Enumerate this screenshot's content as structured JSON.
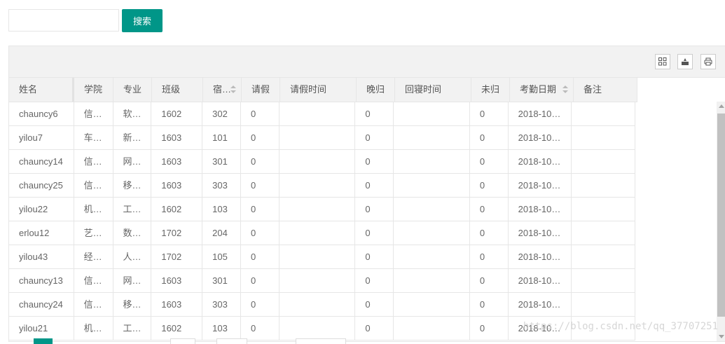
{
  "search": {
    "placeholder": "",
    "value": "",
    "button_label": "搜索"
  },
  "toolbar": {
    "icons": [
      "columns-icon",
      "export-icon",
      "print-icon"
    ]
  },
  "columns": [
    {
      "key": "name",
      "label": "姓名",
      "sortable": false
    },
    {
      "key": "college",
      "label": "学院",
      "sortable": false
    },
    {
      "key": "major",
      "label": "专业",
      "sortable": false
    },
    {
      "key": "class",
      "label": "班级",
      "sortable": false
    },
    {
      "key": "dorm",
      "label": "宿…",
      "sortable": true
    },
    {
      "key": "leave",
      "label": "请假",
      "sortable": false
    },
    {
      "key": "leave_time",
      "label": "请假时间",
      "sortable": false
    },
    {
      "key": "late",
      "label": "晚归",
      "sortable": false
    },
    {
      "key": "return_time",
      "label": "回寝时间",
      "sortable": false
    },
    {
      "key": "absent",
      "label": "未归",
      "sortable": false
    },
    {
      "key": "date",
      "label": "考勤日期",
      "sortable": true
    },
    {
      "key": "remark",
      "label": "备注",
      "sortable": false
    }
  ],
  "rows": [
    [
      "chauncy6",
      "信…",
      "软…",
      "1602",
      "302",
      "0",
      "",
      "0",
      "",
      "0",
      "2018-10…",
      ""
    ],
    [
      "yilou7",
      "车…",
      "新…",
      "1603",
      "101",
      "0",
      "",
      "0",
      "",
      "0",
      "2018-10…",
      ""
    ],
    [
      "chauncy14",
      "信…",
      "网…",
      "1603",
      "301",
      "0",
      "",
      "0",
      "",
      "0",
      "2018-10…",
      ""
    ],
    [
      "chauncy25",
      "信…",
      "移…",
      "1603",
      "303",
      "0",
      "",
      "0",
      "",
      "0",
      "2018-10…",
      ""
    ],
    [
      "yilou22",
      "机…",
      "工…",
      "1602",
      "103",
      "0",
      "",
      "0",
      "",
      "0",
      "2018-10…",
      ""
    ],
    [
      "erlou12",
      "艺…",
      "数…",
      "1702",
      "204",
      "0",
      "",
      "0",
      "",
      "0",
      "2018-10…",
      ""
    ],
    [
      "yilou43",
      "经…",
      "人…",
      "1702",
      "105",
      "0",
      "",
      "0",
      "",
      "0",
      "2018-10…",
      ""
    ],
    [
      "chauncy13",
      "信…",
      "网…",
      "1603",
      "301",
      "0",
      "",
      "0",
      "",
      "0",
      "2018-10…",
      ""
    ],
    [
      "chauncy24",
      "信…",
      "移…",
      "1603",
      "303",
      "0",
      "",
      "0",
      "",
      "0",
      "2018-10…",
      ""
    ],
    [
      "yilou21",
      "机…",
      "工…",
      "1602",
      "103",
      "0",
      "",
      "0",
      "",
      "0",
      "2018-10…",
      ""
    ]
  ],
  "watermark": "https://blog.csdn.net/qq_37707251",
  "colors": {
    "accent": "#009688",
    "header_bg": "#f2f2f2",
    "border": "#e6e6e6"
  }
}
